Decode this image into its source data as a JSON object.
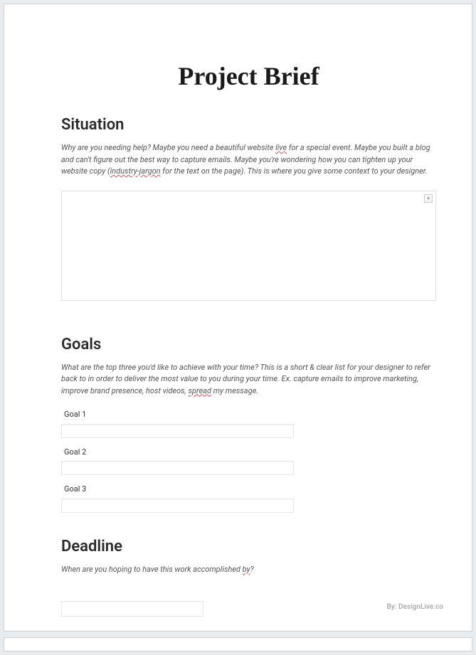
{
  "title": "Project Brief",
  "situation": {
    "heading": "Situation",
    "desc_part1": "Why are you needing help? Maybe you need a beautiful website ",
    "desc_underline1": "live",
    "desc_part2": " for a special event. Maybe you built a blog and can't figure out the best way to capture emails. Maybe you're wondering how you can tighten up your website copy (",
    "desc_underline2": "industry-jargon",
    "desc_part3": " for the text on the page). This is where you give some context to your designer.",
    "value": ""
  },
  "goals": {
    "heading": "Goals",
    "desc_part1": "What are the top three you'd like to achieve with your time? This is a short & clear list for your designer to refer back to in order to deliver the most value to you during your time. Ex. capture emails to improve marketing, improve brand presence, host videos, ",
    "desc_underline1": "spread",
    "desc_part2": " my message.",
    "items": [
      {
        "label": "Goal 1",
        "value": ""
      },
      {
        "label": "Goal 2",
        "value": ""
      },
      {
        "label": "Goal 3",
        "value": ""
      }
    ]
  },
  "deadline": {
    "heading": "Deadline",
    "desc_part1": "When are you hoping to have this work accomplished ",
    "desc_underline1": "by",
    "desc_part2": "?",
    "value": ""
  },
  "footer": {
    "credit": "By: DesignLive.co"
  }
}
